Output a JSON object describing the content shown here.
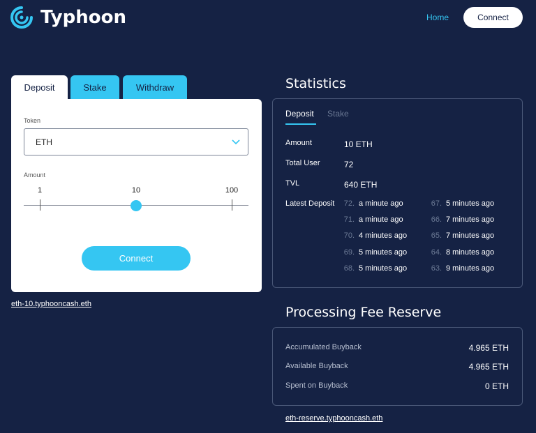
{
  "header": {
    "brand": "Typhoon",
    "nav_home": "Home",
    "nav_connect": "Connect"
  },
  "tabs": [
    {
      "label": "Deposit",
      "active": true
    },
    {
      "label": "Stake",
      "active": false
    },
    {
      "label": "Withdraw",
      "active": false
    }
  ],
  "deposit_form": {
    "token_label": "Token",
    "token_value": "ETH",
    "amount_label": "Amount",
    "amount_options": [
      "1",
      "10",
      "100"
    ],
    "amount_selected": "10",
    "connect_label": "Connect"
  },
  "pool_link": "eth-10.typhooncash.eth",
  "statistics": {
    "title": "Statistics",
    "tabs": [
      "Deposit",
      "Stake"
    ],
    "amount_label": "Amount",
    "amount_value": "10 ETH",
    "total_user_label": "Total User",
    "total_user_value": "72",
    "tvl_label": "TVL",
    "tvl_value": "640 ETH",
    "latest_deposit_label": "Latest Deposit",
    "latest_deposits": [
      {
        "num": "72.",
        "time": "a minute ago"
      },
      {
        "num": "71.",
        "time": "a minute ago"
      },
      {
        "num": "70.",
        "time": "4 minutes ago"
      },
      {
        "num": "69.",
        "time": "5 minutes ago"
      },
      {
        "num": "68.",
        "time": "5 minutes ago"
      },
      {
        "num": "67.",
        "time": "5 minutes ago"
      },
      {
        "num": "66.",
        "time": "7 minutes ago"
      },
      {
        "num": "65.",
        "time": "7 minutes ago"
      },
      {
        "num": "64.",
        "time": "8 minutes ago"
      },
      {
        "num": "63.",
        "time": "9 minutes ago"
      }
    ]
  },
  "fee_reserve": {
    "title": "Processing Fee Reserve",
    "rows": [
      {
        "label": "Accumulated Buyback",
        "value": "4.965 ETH"
      },
      {
        "label": "Available Buyback",
        "value": "4.965 ETH"
      },
      {
        "label": "Spent on Buyback",
        "value": "0 ETH"
      }
    ],
    "link": "eth-reserve.typhooncash.eth"
  },
  "colors": {
    "background": "#152244",
    "accent": "#35c6f2",
    "card": "#ffffff"
  },
  "icons": {
    "logo": "typhoon-swirl-icon",
    "dropdown": "chevron-down-icon"
  }
}
